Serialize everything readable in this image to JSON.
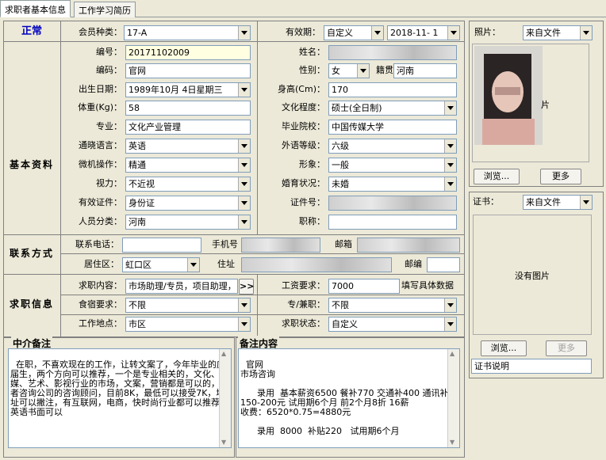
{
  "tabs": [
    "求职者基本信息",
    "工作学习简历"
  ],
  "status": "正常",
  "sections": {
    "basic": "基本资料",
    "contact": "联系方式",
    "job": "求职信息"
  },
  "fields": {
    "member_type_label": "会员种类：",
    "member_type": "17-A",
    "validity_label": "有效期：",
    "validity_mode": "自定义",
    "validity_date": "2018-11- 1",
    "number_label": "编号：",
    "number": "20171102009",
    "name_label": "姓名：",
    "code_label": "编码：",
    "code": "官网",
    "gender_label": "性别：",
    "gender": "女",
    "native_label": "籍贯",
    "native": "河南",
    "birth_label": "出生日期：",
    "birth": "1989年10月 4日星期三",
    "height_label": "身高(Cm)：",
    "height": "170",
    "weight_label": "体重(Kg)：",
    "weight": "58",
    "edu_label": "文化程度：",
    "edu": "硕士(全日制)",
    "major_label": "专业：",
    "major": "文化产业管理",
    "school_label": "毕业院校：",
    "school": "中国传媒大学",
    "lang_label": "通晓语言：",
    "lang": "英语",
    "lang_level_label": "外语等级：",
    "lang_level": "六级",
    "computer_label": "微机操作：",
    "computer": "精通",
    "image_label": "形象：",
    "image": "一般",
    "vision_label": "视力：",
    "vision": "不近视",
    "marital_label": "婚育状况：",
    "marital": "未婚",
    "id_type_label": "有效证件：",
    "id_type": "身份证",
    "id_no_label": "证件号：",
    "category_label": "人员分类：",
    "category": "河南",
    "title_label": "职称：",
    "phone_label": "联系电话：",
    "mobile_label": "手机号",
    "email_label": "邮箱",
    "district_label": "居住区：",
    "district": "虹口区",
    "address_label": "住址",
    "zip_label": "邮编",
    "job_content_label": "求职内容：",
    "job_content": "市场助理/专员，项目助理，",
    "salary_label": "工资要求：",
    "salary": "7000",
    "salary_hint": "填写具体数据",
    "lodging_label": "食宿要求：",
    "lodging": "不限",
    "fulltime_label": "专/兼职：",
    "fulltime": "不限",
    "location_label": "工作地点：",
    "location": "市区",
    "jobstate_label": "求职状态：",
    "jobstate": "自定义"
  },
  "photo": {
    "label": "照片：",
    "source": "来自文件",
    "caption": "片",
    "browse": "浏览...",
    "more": "更多"
  },
  "cert": {
    "label": "证书：",
    "source": "来自文件",
    "empty": "没有图片",
    "browse": "浏览...",
    "more": "更多",
    "desc": "证书说明"
  },
  "agent_note": {
    "title": "中介备注",
    "text": "在职，不喜欢现在的工作，让转文案了，今年毕业的应届生，两个方向可以推荐，一个是专业相关的，文化、传媒、艺术、影视行业的市场，文案，营销都是可以的，或者咨询公司的咨询顾问，目前8K，最低可以接受7K，地址可以撇注，有互联网，电商，快时尚行业都可以推荐，英语书面可以"
  },
  "remark": {
    "title": "备注内容",
    "text": "官网\n市场咨询\n\n      录用  基本薪资6500 餐补770 交通补400 通讯补150-200元 试用期6个月 前2个月8折 16薪\n收费：6520*0.75=4880元\n\n      录用  8000  补贴220   试用期6个月"
  },
  "more_btn": ">>"
}
